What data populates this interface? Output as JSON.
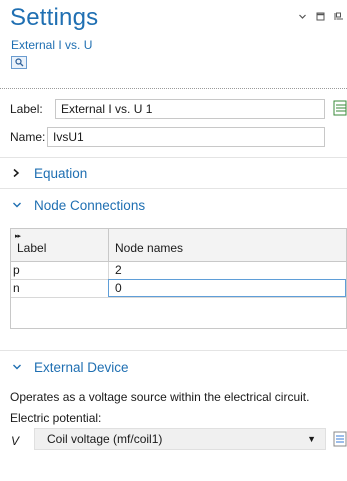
{
  "header": {
    "title": "Settings",
    "subtitle": "External I vs. U"
  },
  "icons": {
    "search": "search-icon",
    "dropdown": "chevron-down-icon",
    "restore": "restore-window-icon",
    "pin": "pin-icon",
    "document": "document-icon",
    "insert": "insert-expression-icon"
  },
  "fields": {
    "label_caption": "Label:",
    "label_value": "External I vs. U 1",
    "name_caption": "Name:",
    "name_value": "IvsU1"
  },
  "sections": {
    "equation": {
      "label": "Equation",
      "chevron": "›"
    },
    "node_connections": {
      "label": "Node Connections",
      "chevron": "⌄"
    },
    "external_device": {
      "label": "External Device",
      "chevron": "⌄"
    }
  },
  "table": {
    "columns": [
      "Label",
      "Node names"
    ],
    "rows": [
      {
        "label": "p",
        "node": "2"
      },
      {
        "label": "n",
        "node": "0"
      }
    ]
  },
  "external_device": {
    "description": "Operates as a voltage source within the electrical circuit.",
    "potential_caption": "Electric potential:",
    "variable": "V",
    "selected": "Coil voltage (mf/coil1)"
  },
  "colors": {
    "accent": "#1f6fb2",
    "border": "#c8c8c8",
    "selection": "#5f9ed8"
  }
}
